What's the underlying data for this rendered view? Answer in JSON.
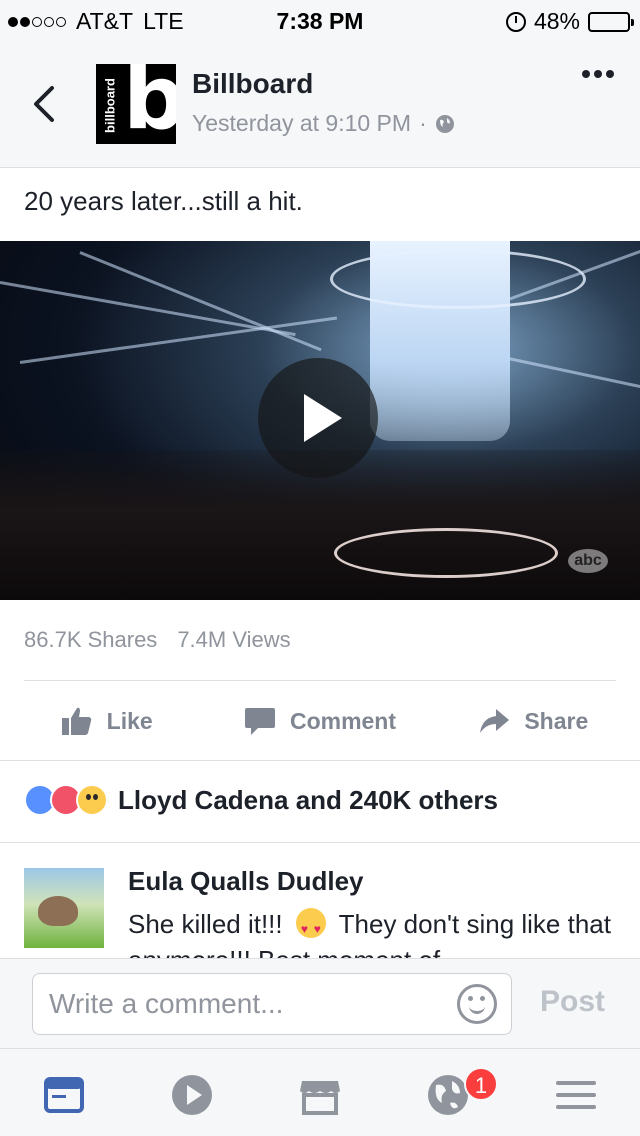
{
  "status_bar": {
    "carrier": "AT&T",
    "network": "LTE",
    "time": "7:38 PM",
    "battery": "48%",
    "battery_level": 0.48,
    "signal_bars_filled": 2,
    "signal_bars_total": 5
  },
  "post": {
    "page_name": "Billboard",
    "logo_letter": "b",
    "logo_text": "billboard",
    "timestamp": "Yesterday at 9:10 PM",
    "separator": "·",
    "caption": "20 years later...still a hit.",
    "video_watermark": "abc",
    "shares": "86.7K Shares",
    "views": "7.4M Views"
  },
  "actions": {
    "like": "Like",
    "comment": "Comment",
    "share": "Share"
  },
  "reactions": {
    "summary": "Lloyd Cadena and 240K others"
  },
  "comment": {
    "author": "Eula Qualls Dudley",
    "text_before_emoji": "She killed it!!!",
    "text_after_emoji": "They don't sing like that anymore!!! Best moment of"
  },
  "composer": {
    "placeholder": "Write a comment...",
    "post_label": "Post"
  },
  "tabbar": {
    "notifications_badge": "1"
  },
  "colors": {
    "facebook_blue": "#4267b2",
    "secondary_text": "#90949c",
    "badge_red": "#fa3e3e"
  }
}
